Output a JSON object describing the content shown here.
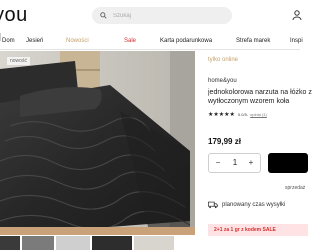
{
  "header": {
    "logo": "you",
    "search_placeholder": "Szukaj",
    "user_icon": "user-icon",
    "search_icon": "search-icon"
  },
  "nav": {
    "items": [
      "Dom",
      "Jesień",
      "Nowości",
      "Sale",
      "Karta podarunkowa",
      "Strefa marek",
      "Inspi"
    ]
  },
  "product": {
    "image_badge": "nowość",
    "availability": "tylko online",
    "brand": "home&you",
    "title_line1": "jednokolorowa narzuta na łóżko z",
    "title_line2": "wytłoczonym wzorem koła",
    "rating_value": "5.0/5",
    "rating_sep": " - ",
    "opinions": "opinia (1)",
    "price": "179,99 zł",
    "quantity": "1",
    "minus_label": "−",
    "plus_label": "+",
    "seller_text": "sprzedaż",
    "delivery_text": "planowany czas wysyłki",
    "promo_text": "2+1 za 1 gr z kodem SALE"
  },
  "colors": {
    "accent": "#d32f2f",
    "nav_highlight": "#c5a06b",
    "online_label": "#c5a06b",
    "button": "#000000"
  }
}
